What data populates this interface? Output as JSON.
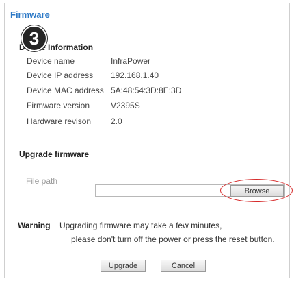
{
  "page": {
    "title": "Firmware"
  },
  "step_badge": "3",
  "device_info": {
    "heading": "Device Information",
    "rows": [
      {
        "label": "Device name",
        "value": "InfraPower"
      },
      {
        "label": "Device IP address",
        "value": "192.168.1.40"
      },
      {
        "label": "Device MAC address",
        "value": "5A:48:54:3D:8E:3D"
      },
      {
        "label": "Firmware version",
        "value": "V2395S"
      },
      {
        "label": "Hardware revison",
        "value": "2.0"
      }
    ]
  },
  "upgrade": {
    "heading": "Upgrade firmware",
    "file_path_label": "File path",
    "file_path_value": "",
    "browse_label": "Browse"
  },
  "warning": {
    "label": "Warning",
    "line1": "Upgrading firmware may take a few minutes,",
    "line2": "please don't turn off the power or press the reset button."
  },
  "actions": {
    "upgrade_label": "Upgrade",
    "cancel_label": "Cancel"
  },
  "colors": {
    "title": "#2b78c6",
    "highlight": "#d62b2b",
    "badge": "#262626"
  }
}
